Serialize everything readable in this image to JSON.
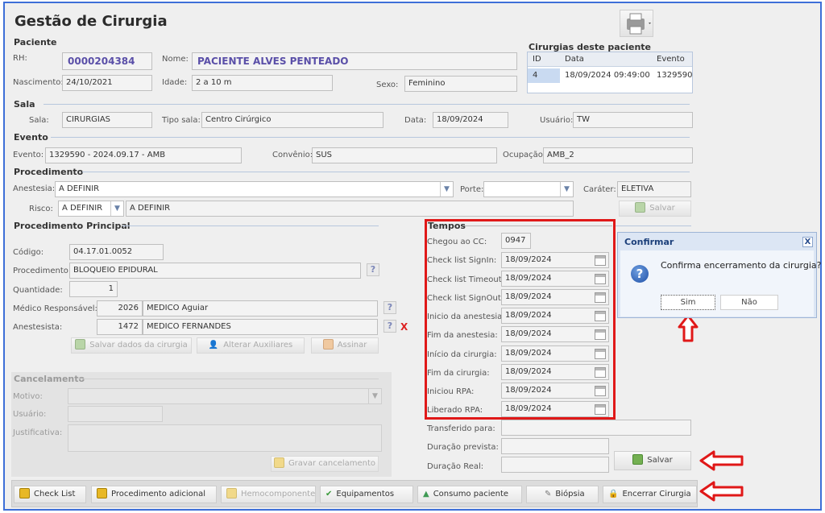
{
  "page": {
    "title": "Gestão de Cirurgia"
  },
  "paciente": {
    "section": "Paciente",
    "rh_label": "RH:",
    "rh": "0000204384",
    "nome_label": "Nome:",
    "nome": "PACIENTE ALVES PENTEADO",
    "nascimento_label": "Nascimento:",
    "nascimento": "24/10/2021",
    "idade_label": "Idade:",
    "idade": "2 a 10 m",
    "sexo_label": "Sexo:",
    "sexo": "Feminino"
  },
  "cirurgias": {
    "title": "Cirurgias deste paciente",
    "headers": [
      "ID",
      "Data",
      "Evento"
    ],
    "rows": [
      [
        "4",
        "18/09/2024 09:49:00",
        "1329590"
      ]
    ]
  },
  "sala": {
    "section": "Sala",
    "sala_label": "Sala:",
    "sala": "CIRURGIAS",
    "tipo_label": "Tipo sala:",
    "tipo": "Centro Cirúrgico",
    "data_label": "Data:",
    "data": "18/09/2024",
    "usuario_label": "Usuário:",
    "usuario": "TW"
  },
  "evento": {
    "section": "Evento",
    "evento_label": "Evento:",
    "evento": "1329590 - 2024.09.17 - AMB",
    "convenio_label": "Convênio:",
    "convenio": "SUS",
    "ocupacao_label": "Ocupação:",
    "ocupacao": "AMB_2"
  },
  "procedimento": {
    "section": "Procedimento",
    "anestesia_label": "Anestesia:",
    "anestesia": "A DEFINIR",
    "porte_label": "Porte:",
    "porte": "",
    "carater_label": "Caráter:",
    "carater": "ELETIVA",
    "risco_label": "Risco:",
    "risco": "A DEFINIR",
    "risco_desc": "A DEFINIR",
    "salvar": "Salvar"
  },
  "principal": {
    "section": "Procedimento Principal",
    "codigo_label": "Código:",
    "codigo": "04.17.01.0052",
    "procedimento_label": "Procedimento:",
    "procedimento": "BLOQUEIO EPIDURAL",
    "quantidade_label": "Quantidade:",
    "quantidade": "1",
    "medico_label": "Médico Responsável:",
    "medico_id": "2026",
    "medico": "MEDICO Aguiar",
    "anestesista_label": "Anestesista:",
    "anestesista_id": "1472",
    "anestesista": "MEDICO FERNANDES",
    "btn_salvar": "Salvar dados da cirurgia",
    "btn_auxiliares": "Alterar Auxiliares",
    "btn_assinar": "Assinar",
    "help": "?",
    "remove": "X"
  },
  "cancelamento": {
    "section": "Cancelamento",
    "motivo_label": "Motivo:",
    "usuario_label": "Usuário:",
    "justificativa_label": "Justificativa:",
    "btn_gravar": "Gravar cancelamento"
  },
  "tempos": {
    "section": "Tempos",
    "chegou_label": "Chegou ao CC:",
    "chegou": "0947",
    "items": [
      {
        "label": "Check list SignIn:",
        "value": "18/09/2024"
      },
      {
        "label": "Check list Timeout:",
        "value": "18/09/2024"
      },
      {
        "label": "Check list SignOut:",
        "value": "18/09/2024"
      },
      {
        "label": "Inicio da anestesia:",
        "value": "18/09/2024"
      },
      {
        "label": "Fim da anestesia:",
        "value": "18/09/2024"
      },
      {
        "label": "Início da cirurgia:",
        "value": "18/09/2024"
      },
      {
        "label": "Fim da cirurgia:",
        "value": "18/09/2024"
      },
      {
        "label": "Iniciou RPA:",
        "value": "18/09/2024"
      },
      {
        "label": "Liberado RPA:",
        "value": "18/09/2024"
      }
    ],
    "transferido_label": "Transferido para:",
    "duracao_prevista_label": "Duração prevista:",
    "duracao_real_label": "Duração Real:",
    "salvar": "Salvar"
  },
  "dialog": {
    "title": "Confirmar",
    "close": "X",
    "message": "Confirma encerramento da cirurgia?",
    "icon": "?",
    "yes": "Sim",
    "no": "Não"
  },
  "bottom": {
    "check_list": "Check List",
    "proc_adicional": "Procedimento adicional",
    "hemocomponente": "Hemocomponente",
    "equipamentos": "Equipamentos",
    "consumo": "Consumo paciente",
    "biopsia": "Biópsia",
    "encerrar": "Encerrar Cirurgia"
  },
  "colors": {
    "highlight_red": "#e01818",
    "accent_blue": "#3d6fd8"
  }
}
